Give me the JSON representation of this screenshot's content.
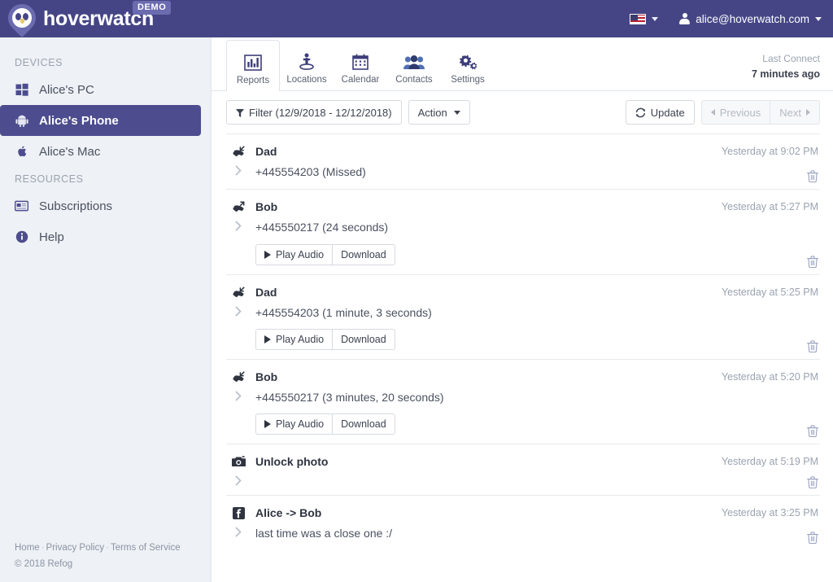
{
  "header": {
    "brand": "hoverwatch",
    "badge": "DEMO",
    "language_icon": "us-flag-icon",
    "account_email": "alice@hoverwatch.com",
    "brand_color": "#454586",
    "accent_color": "#6b6bb0"
  },
  "sidebar": {
    "groups": [
      {
        "label": "DEVICES",
        "items": [
          {
            "label": "Alice's PC",
            "icon": "windows-icon",
            "active": false
          },
          {
            "label": "Alice's Phone",
            "icon": "android-icon",
            "active": true
          },
          {
            "label": "Alice's Mac",
            "icon": "apple-icon",
            "active": false
          }
        ]
      },
      {
        "label": "RESOURCES",
        "items": [
          {
            "label": "Subscriptions",
            "icon": "card-icon",
            "active": false
          },
          {
            "label": "Help",
            "icon": "info-icon",
            "active": false
          }
        ]
      }
    ],
    "footer": {
      "links": [
        "Home",
        "Privacy Policy",
        "Terms of Service"
      ],
      "copyright": "© 2018 Refog"
    }
  },
  "tabs": [
    {
      "label": "Reports",
      "icon": "bar-chart-icon",
      "active": true
    },
    {
      "label": "Locations",
      "icon": "pin-person-icon",
      "active": false
    },
    {
      "label": "Calendar",
      "icon": "calendar-icon",
      "active": false
    },
    {
      "label": "Contacts",
      "icon": "people-icon",
      "active": false
    },
    {
      "label": "Settings",
      "icon": "gears-icon",
      "active": false
    }
  ],
  "last_connect": {
    "label": "Last Connect",
    "value": "7 minutes ago"
  },
  "controls": {
    "filter_label": "Filter (12/9/2018 - 12/12/2018)",
    "action_label": "Action",
    "update_label": "Update",
    "previous_label": "Previous",
    "next_label": "Next",
    "previous_disabled": true,
    "next_disabled": true
  },
  "media_buttons": {
    "play_label": "Play Audio",
    "download_label": "Download"
  },
  "entries": [
    {
      "icon": "call-incoming-icon",
      "title": "Dad",
      "detail": "+445554203 (Missed)",
      "time": "Yesterday at 9:02 PM",
      "has_media": false
    },
    {
      "icon": "call-outgoing-icon",
      "title": "Bob",
      "detail": "+445550217 (24 seconds)",
      "time": "Yesterday at 5:27 PM",
      "has_media": true
    },
    {
      "icon": "call-incoming-icon",
      "title": "Dad",
      "detail": "+445554203 (1 minute, 3 seconds)",
      "time": "Yesterday at 5:25 PM",
      "has_media": true
    },
    {
      "icon": "call-incoming-icon",
      "title": "Bob",
      "detail": "+445550217 (3 minutes, 20 seconds)",
      "time": "Yesterday at 5:20 PM",
      "has_media": true
    },
    {
      "icon": "camera-icon",
      "title": "Unlock photo",
      "detail": "",
      "time": "Yesterday at 5:19 PM",
      "has_media": false
    },
    {
      "icon": "facebook-icon",
      "title": "Alice -> Bob",
      "detail": "last time was a close one :/",
      "time": "Yesterday at 3:25 PM",
      "has_media": false
    }
  ]
}
